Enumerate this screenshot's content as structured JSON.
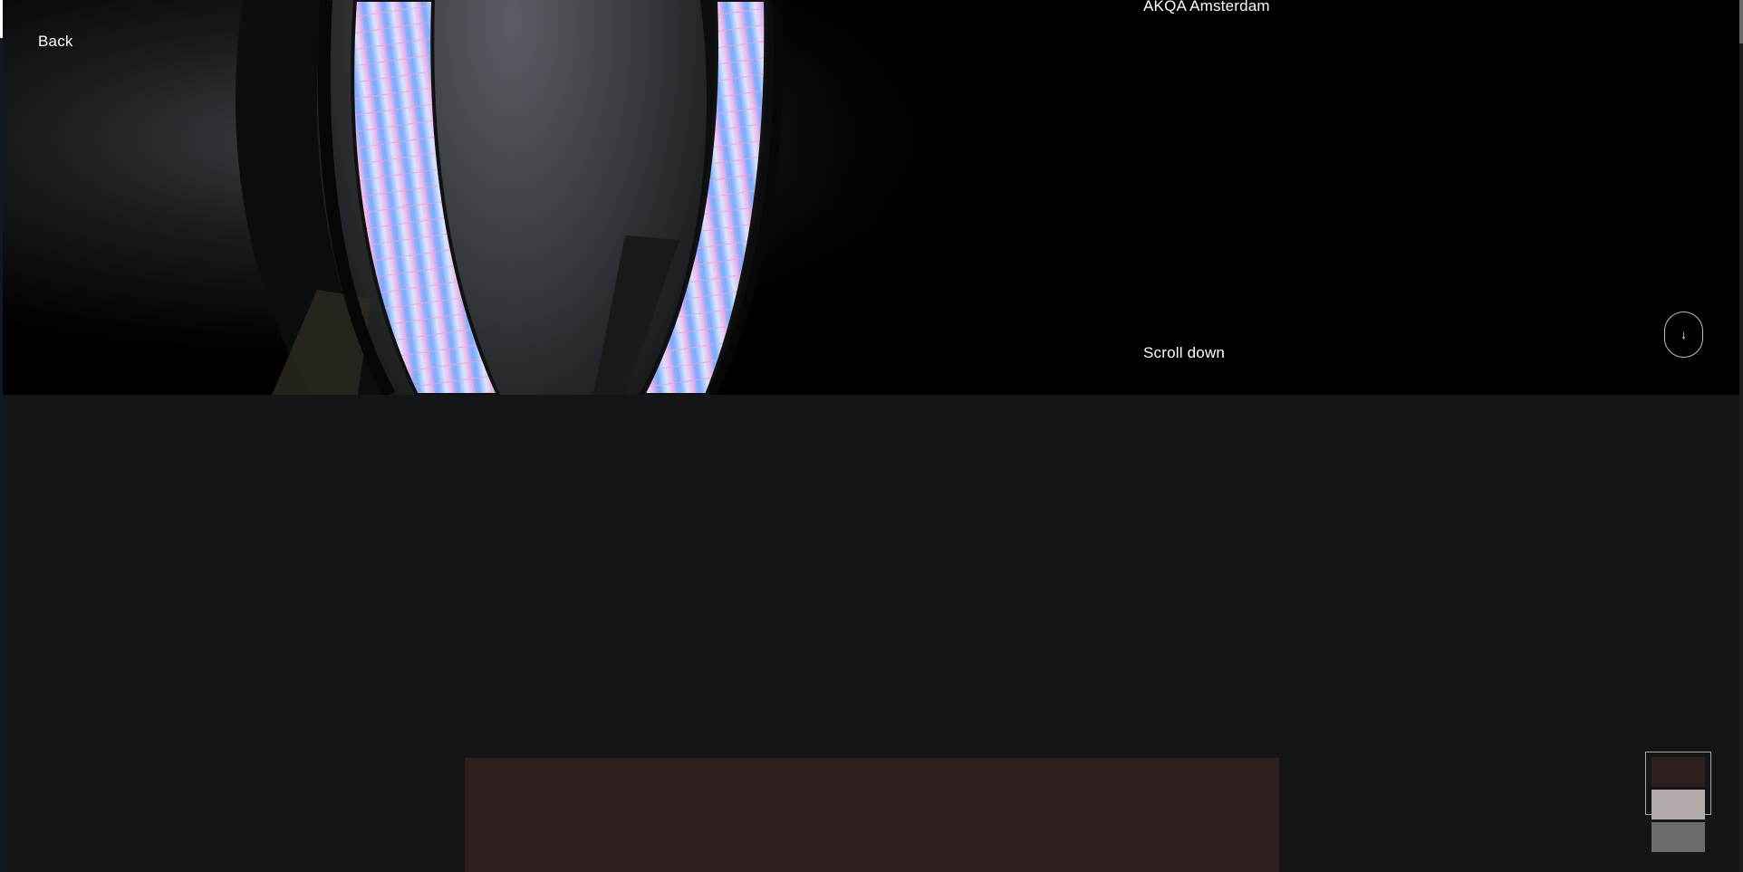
{
  "nav": {
    "back_label": "Back"
  },
  "hero": {
    "agency_label": "AKQA Amsterdam",
    "scroll_label": "Scroll down",
    "scroll_icon": "↓",
    "image_icon": "illuminated-ring-sculpture"
  },
  "colors": {
    "page_background": "#141516",
    "hero_background": "#000000",
    "content_block": "#2c1f1e",
    "minimap_slide_1": "#2c1f1e",
    "minimap_slide_2": "#b3acaa",
    "minimap_slide_3": "#6b6b6b",
    "ring_glow": "#8fb4ff"
  },
  "progress": {
    "scroll_fraction": 0.04
  },
  "minimap": {
    "active_slide": 1,
    "slide_count": 3
  }
}
